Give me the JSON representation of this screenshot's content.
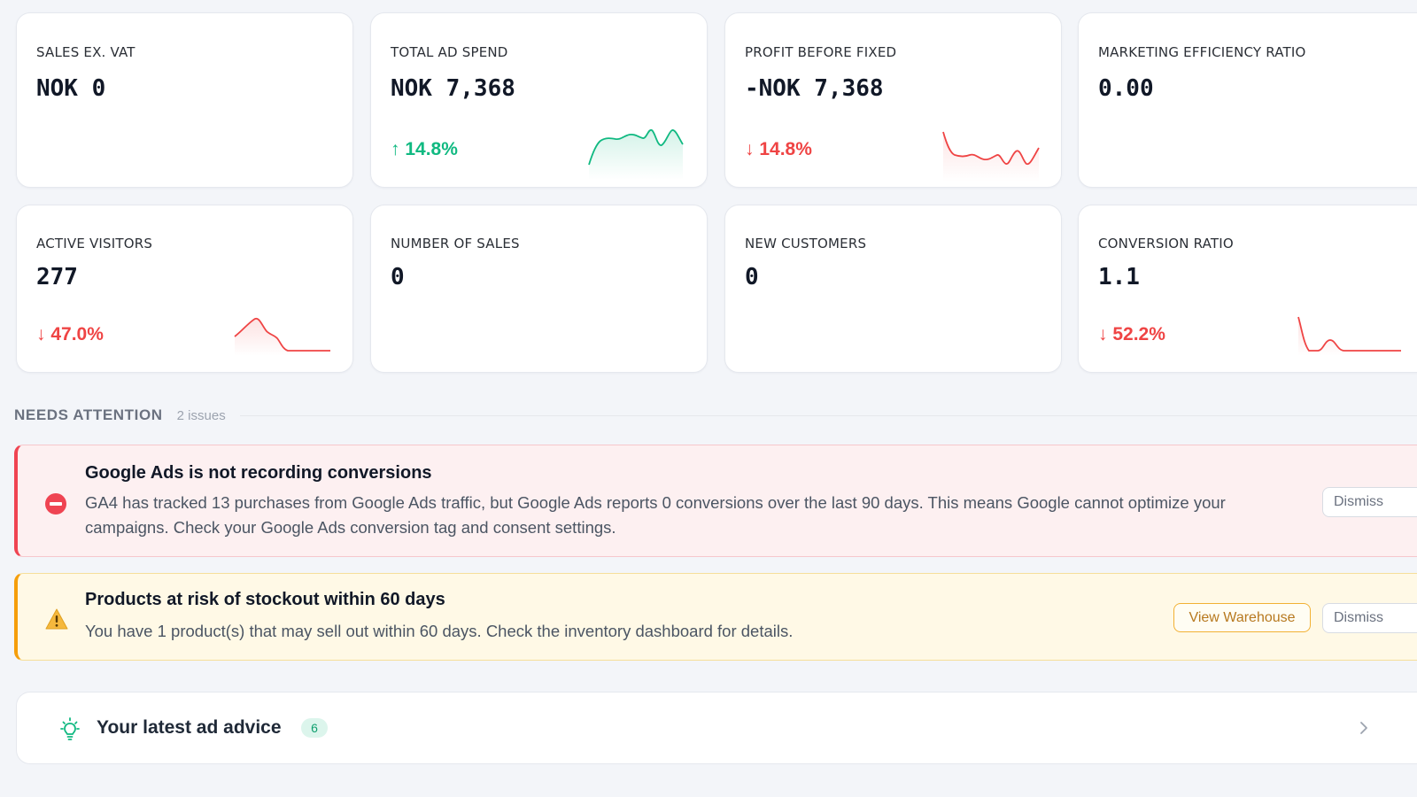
{
  "metrics": {
    "sales_ex_vat": {
      "label": "SALES EX. VAT",
      "value": "NOK 0"
    },
    "total_ad_spend": {
      "label": "TOTAL AD SPEND",
      "value": "NOK 7,368",
      "change": "↑ 14.8%",
      "trend": "up",
      "trend_color": "#10b981"
    },
    "profit_before_fixed": {
      "label": "PROFIT BEFORE FIXED",
      "value": "-NOK 7,368",
      "change": "↓ 14.8%",
      "trend": "down",
      "trend_color": "#ef4444"
    },
    "marketing_efficiency_ratio": {
      "label": "MARKETING EFFICIENCY RATIO",
      "value": "0.00"
    },
    "active_visitors": {
      "label": "ACTIVE VISITORS",
      "value": "277",
      "change": "↓ 47.0%",
      "trend": "down",
      "trend_color": "#ef4444"
    },
    "number_of_sales": {
      "label": "NUMBER OF SALES",
      "value": "0"
    },
    "new_customers": {
      "label": "NEW CUSTOMERS",
      "value": "0"
    },
    "conversion_ratio": {
      "label": "CONVERSION RATIO",
      "value": "1.1",
      "change": "↓ 52.2%",
      "trend": "down",
      "trend_color": "#ef4444"
    }
  },
  "attention": {
    "title": "NEEDS ATTENTION",
    "count": "2 issues",
    "alerts": [
      {
        "severity": "error",
        "color": "#ef4452",
        "title": "Google Ads is not recording conversions",
        "body": "GA4 has tracked 13 purchases from Google Ads traffic, but Google Ads reports 0 conversions over the last 90 days. This means Google cannot optimize your campaigns. Check your Google Ads conversion tag and consent settings.",
        "dismiss_label": "Dismiss"
      },
      {
        "severity": "warning",
        "color": "#f59e0b",
        "title": "Products at risk of stockout within 60 days",
        "body": "You have 1 product(s) that may sell out within 60 days. Check the inventory dashboard for details.",
        "action_label": "View Warehouse",
        "dismiss_label": "Dismiss"
      }
    ]
  },
  "advice": {
    "title": "Your latest ad advice",
    "badge": "6",
    "icon": "lightbulb-icon"
  }
}
